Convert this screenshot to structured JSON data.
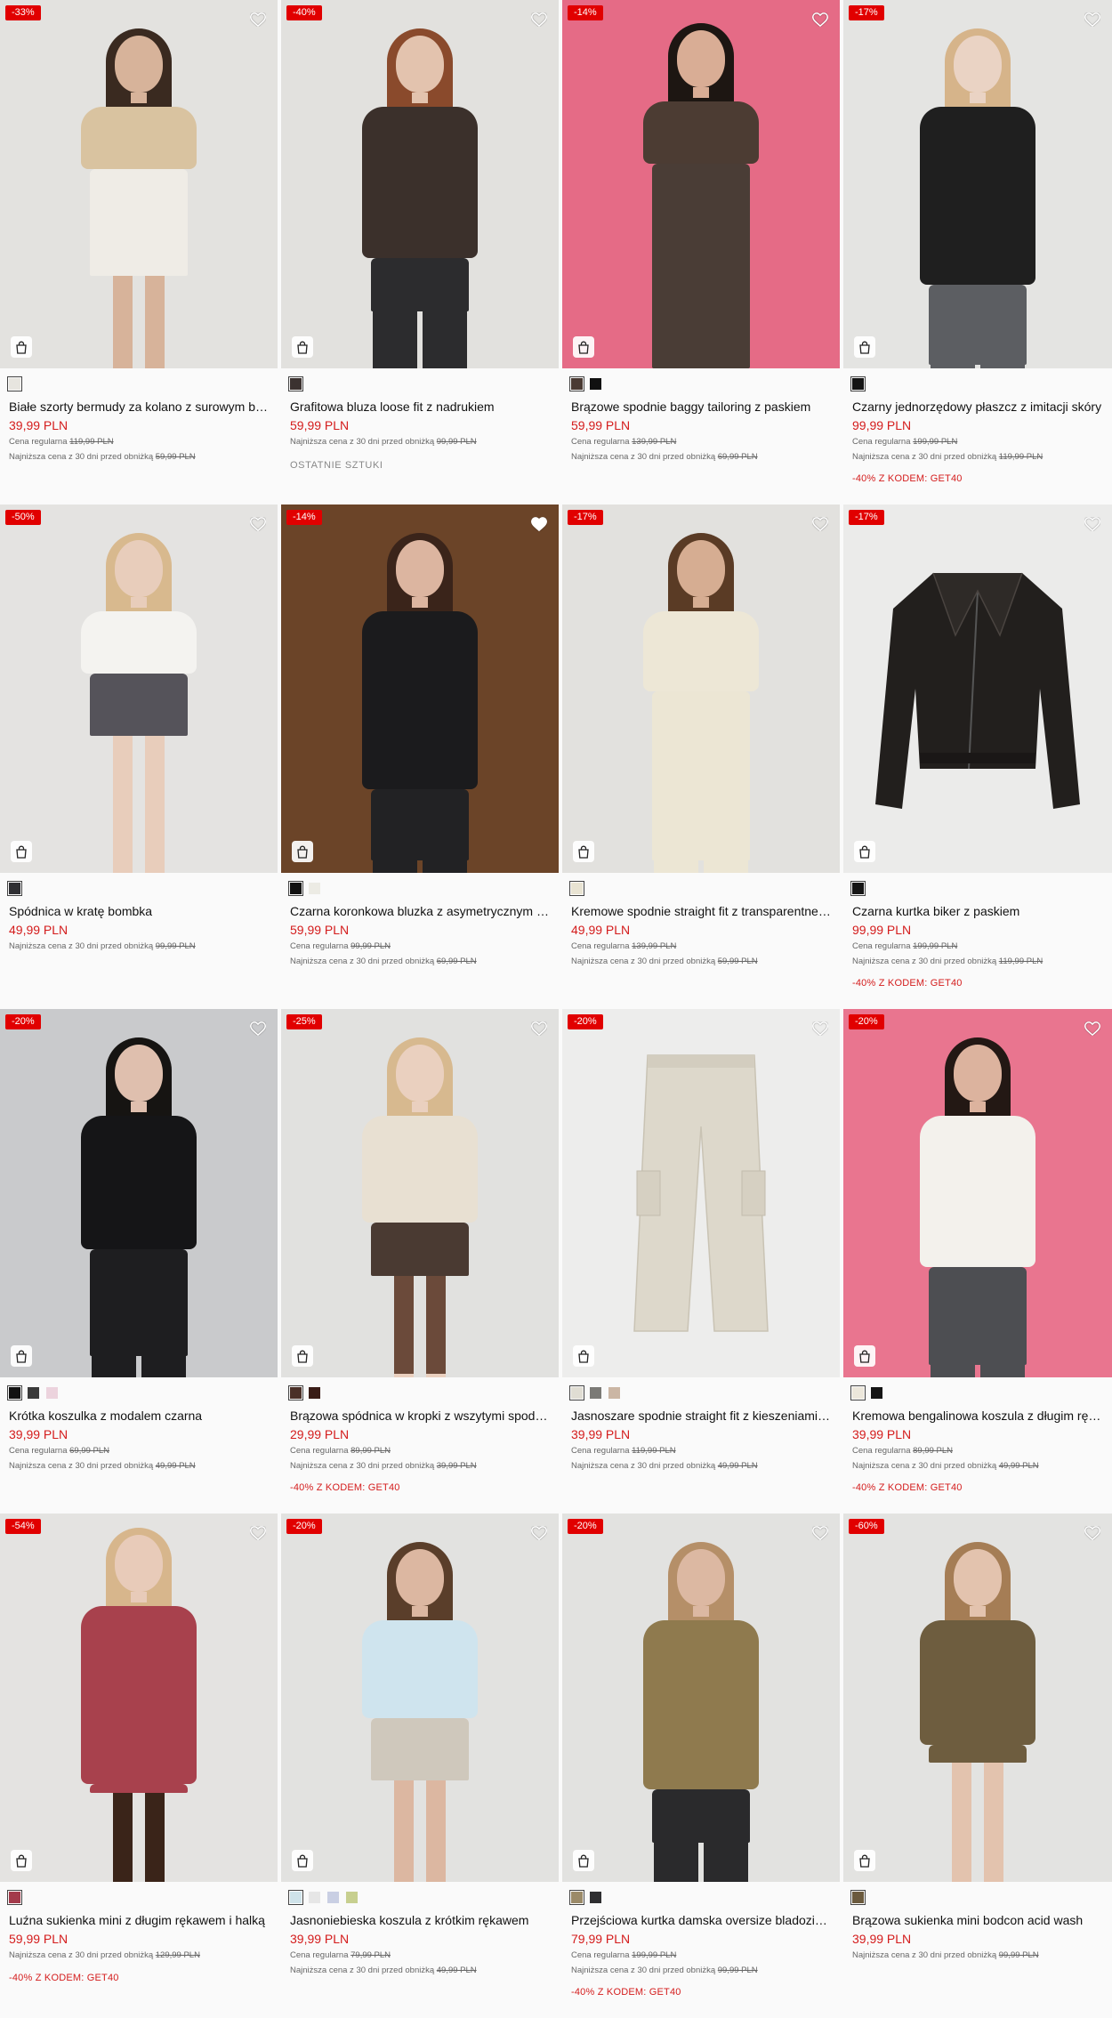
{
  "icons": {
    "favorite": "heart-icon",
    "add_to_cart": "shopping-bag-icon"
  },
  "labels": {
    "regular_price_prefix": "Cena regularna",
    "lowest_price_prefix": "Najniższa cena z 30 dni przed obniżką"
  },
  "colors": {
    "badge_bg": "#e10000",
    "sale_price": "#d41c1c",
    "page_bg": "#fafafa"
  },
  "products": [
    {
      "discount": "-33%",
      "name": "Białe szorty bermudy za kolano z surowym brzegiem",
      "price": "39,99 PLN",
      "regular_price": "119,99 PLN",
      "lowest_price": "59,99 PLN",
      "promo": "",
      "status": "",
      "favorite_filled": false,
      "swatches": [
        {
          "color": "#e7e5df",
          "selected": true
        }
      ],
      "bg": "#e3e2df",
      "art": "model",
      "hair": "#3a2a20",
      "skin": "#d7b39a",
      "top": "#d9c3a0",
      "top_h": 70,
      "bottom": "#efece6",
      "bottom_h": 120,
      "legs": "#d7b39a",
      "legs_h": 60
    },
    {
      "discount": "-40%",
      "name": "Grafitowa bluza loose fit z nadrukiem",
      "price": "59,99 PLN",
      "regular_price": "",
      "lowest_price": "99,99 PLN",
      "promo": "",
      "status": "OSTATNIE SZTUKI",
      "favorite_filled": false,
      "swatches": [
        {
          "color": "#3b3230",
          "selected": true
        }
      ],
      "bg": "#e2e1de",
      "art": "model",
      "hair": "#8a4a2c",
      "skin": "#e3c3ae",
      "top": "#3b302b",
      "top_h": 170,
      "bottom": "#2c2c2e",
      "bottom_h": 60,
      "legs": "#2c2c2e",
      "legs_h": 0
    },
    {
      "discount": "-14%",
      "name": "Brązowe spodnie baggy tailoring z paskiem",
      "price": "59,99 PLN",
      "regular_price": "139,99 PLN",
      "lowest_price": "69,99 PLN",
      "promo": "",
      "status": "",
      "favorite_filled": false,
      "swatches": [
        {
          "color": "#4a3a33",
          "selected": true
        },
        {
          "color": "#111111",
          "selected": false
        }
      ],
      "bg": "#e56b86",
      "art": "model",
      "hair": "#1d1612",
      "skin": "#d9ad95",
      "top": "#4c3c33",
      "top_h": 70,
      "bottom": "#4a3d36",
      "bottom_h": 230,
      "legs": "#4a3d36",
      "legs_h": 0
    },
    {
      "discount": "-17%",
      "name": "Czarny jednorzędowy płaszcz z imitacji skóry",
      "price": "99,99 PLN",
      "regular_price": "199,99 PLN",
      "lowest_price": "119,99 PLN",
      "promo": "-40% Z KODEM: GET40",
      "status": "",
      "favorite_filled": false,
      "swatches": [
        {
          "color": "#151515",
          "selected": true
        }
      ],
      "bg": "#e4e4e2",
      "art": "model",
      "hair": "#d6b48a",
      "skin": "#ead3c4",
      "top": "#1f1f1f",
      "top_h": 200,
      "bottom": "#5c5e62",
      "bottom_h": 90,
      "legs": "#5c5e62",
      "legs_h": 0
    },
    {
      "discount": "-50%",
      "name": "Spódnica w kratę bombka",
      "price": "49,99 PLN",
      "regular_price": "",
      "lowest_price": "99,99 PLN",
      "promo": "",
      "status": "",
      "favorite_filled": false,
      "swatches": [
        {
          "color": "#2f2f33",
          "selected": true
        }
      ],
      "bg": "#e4e3e1",
      "art": "model",
      "hair": "#d8b98e",
      "skin": "#e8cdbb",
      "top": "#f4f3f0",
      "top_h": 70,
      "bottom": "#55535a",
      "bottom_h": 70,
      "legs": "#e8cdbb",
      "legs_h": 100
    },
    {
      "discount": "-14%",
      "name": "Czarna koronkowa bluzka z asymetrycznym dekoltem",
      "price": "59,99 PLN",
      "regular_price": "99,99 PLN",
      "lowest_price": "69,99 PLN",
      "promo": "",
      "status": "",
      "favorite_filled": true,
      "swatches": [
        {
          "color": "#111111",
          "selected": true
        },
        {
          "color": "#ecebe4",
          "selected": false
        }
      ],
      "bg": "#6b4428",
      "art": "model",
      "hair": "#3a241a",
      "skin": "#dcb5a0",
      "top": "#1b1b1d",
      "top_h": 200,
      "bottom": "#222224",
      "bottom_h": 80,
      "legs": "#222224",
      "legs_h": 0
    },
    {
      "discount": "-17%",
      "name": "Kremowe spodnie straight fit z transparentnej dzianiny",
      "price": "49,99 PLN",
      "regular_price": "139,99 PLN",
      "lowest_price": "59,99 PLN",
      "promo": "",
      "status": "",
      "favorite_filled": false,
      "swatches": [
        {
          "color": "#e8e3d2",
          "selected": true
        }
      ],
      "bg": "#e2e1de",
      "art": "model",
      "hair": "#5a3b25",
      "skin": "#d6ad92",
      "top": "#ede7d6",
      "top_h": 90,
      "bottom": "#ece6d4",
      "bottom_h": 190,
      "legs": "#ece6d4",
      "legs_h": 0
    },
    {
      "discount": "-17%",
      "name": "Czarna kurtka biker z paskiem",
      "price": "99,99 PLN",
      "regular_price": "199,99 PLN",
      "lowest_price": "119,99 PLN",
      "promo": "-40% Z KODEM: GET40",
      "status": "",
      "favorite_filled": false,
      "swatches": [
        {
          "color": "#151515",
          "selected": true
        }
      ],
      "bg": "#ebebea",
      "art": "jacket",
      "garment": "#221f1d"
    },
    {
      "discount": "-20%",
      "name": "Krótka koszulka z modalem czarna",
      "price": "39,99 PLN",
      "regular_price": "69,99 PLN",
      "lowest_price": "49,99 PLN",
      "promo": "",
      "status": "",
      "favorite_filled": false,
      "swatches": [
        {
          "color": "#111111",
          "selected": true
        },
        {
          "color": "#3a3a3a",
          "selected": false
        },
        {
          "color": "#ecd3dd",
          "selected": false
        }
      ],
      "bg": "#c9cacc",
      "art": "model",
      "hair": "#161412",
      "skin": "#dfbfae",
      "top": "#151517",
      "top_h": 150,
      "bottom": "#1e1e20",
      "bottom_h": 120,
      "legs": "#1e1e20",
      "legs_h": 0
    },
    {
      "discount": "-25%",
      "name": "Brązowa spódnica w kropki z wszytymi spodenkami",
      "price": "29,99 PLN",
      "regular_price": "89,99 PLN",
      "lowest_price": "39,99 PLN",
      "promo": "-40% Z KODEM: GET40",
      "status": "",
      "favorite_filled": false,
      "swatches": [
        {
          "color": "#4a3028",
          "selected": true
        },
        {
          "color": "#3a1d17",
          "selected": false
        }
      ],
      "bg": "#e1e1df",
      "art": "model",
      "hair": "#d7b98f",
      "skin": "#ead0bf",
      "top": "#e8e0d2",
      "top_h": 120,
      "bottom": "#4a3a32",
      "bottom_h": 60,
      "legs": "#6b4a3a",
      "legs_h": 110
    },
    {
      "discount": "-20%",
      "name": "Jasnoszare spodnie straight fit z kieszeniami cargo",
      "price": "39,99 PLN",
      "regular_price": "119,99 PLN",
      "lowest_price": "49,99 PLN",
      "promo": "",
      "status": "",
      "favorite_filled": false,
      "swatches": [
        {
          "color": "#e0ddd3",
          "selected": true
        },
        {
          "color": "#7b7a76",
          "selected": false
        },
        {
          "color": "#cbb6a4",
          "selected": false
        }
      ],
      "bg": "#ededec",
      "art": "trousers",
      "garment": "#ddd8cb"
    },
    {
      "discount": "-20%",
      "name": "Kremowa bengalinowa koszula z długim rękawem",
      "price": "39,99 PLN",
      "regular_price": "89,99 PLN",
      "lowest_price": "49,99 PLN",
      "promo": "-40% Z KODEM: GET40",
      "status": "",
      "favorite_filled": false,
      "swatches": [
        {
          "color": "#ece7db",
          "selected": true
        },
        {
          "color": "#151515",
          "selected": false
        }
      ],
      "bg": "#e9758f",
      "art": "model",
      "hair": "#231814",
      "skin": "#dcb39e",
      "top": "#f3f1ec",
      "top_h": 170,
      "bottom": "#4d4e52",
      "bottom_h": 110,
      "legs": "#4d4e52",
      "legs_h": 0
    },
    {
      "discount": "-54%",
      "name": "Luźna sukienka mini z długim rękawem i halką",
      "price": "59,99 PLN",
      "regular_price": "",
      "lowest_price": "129,99 PLN",
      "promo": "-40% Z KODEM: GET40",
      "status": "",
      "favorite_filled": false,
      "swatches": [
        {
          "color": "#a33a4a",
          "selected": true
        }
      ],
      "bg": "#e4e3e1",
      "art": "model",
      "hair": "#d7b68c",
      "skin": "#e8cbb9",
      "top": "#a8414d",
      "top_h": 200,
      "bottom": "#a8414d",
      "bottom_h": 10,
      "legs": "#3a2419",
      "legs_h": 100
    },
    {
      "discount": "-20%",
      "name": "Jasnoniebieska koszula z krótkim rękawem",
      "price": "39,99 PLN",
      "regular_price": "79,99 PLN",
      "lowest_price": "49,99 PLN",
      "promo": "",
      "status": "",
      "favorite_filled": false,
      "swatches": [
        {
          "color": "#cfe3ea",
          "selected": true
        },
        {
          "color": "#e6e6e6",
          "selected": false
        },
        {
          "color": "#c9cfe3",
          "selected": false
        },
        {
          "color": "#c7cf8f",
          "selected": false
        }
      ],
      "bg": "#e2e2e0",
      "art": "model",
      "hair": "#5a3e2a",
      "skin": "#dcb7a1",
      "top": "#cfe4ee",
      "top_h": 110,
      "bottom": "#cfc8bc",
      "bottom_h": 70,
      "legs": "#dcb7a1",
      "legs_h": 40
    },
    {
      "discount": "-20%",
      "name": "Przejściowa kurtka damska oversize bladozielona",
      "price": "79,99 PLN",
      "regular_price": "199,99 PLN",
      "lowest_price": "99,99 PLN",
      "promo": "-40% Z KODEM: GET40",
      "status": "",
      "favorite_filled": false,
      "swatches": [
        {
          "color": "#9b8a68",
          "selected": true
        },
        {
          "color": "#2e2e30",
          "selected": false
        }
      ],
      "bg": "#e2e2e0",
      "art": "model",
      "hair": "#b58f68",
      "skin": "#dcb8a2",
      "top": "#8f7a4e",
      "top_h": 190,
      "bottom": "#2a2a2c",
      "bottom_h": 60,
      "legs": "#2a2a2c",
      "legs_h": 0
    },
    {
      "discount": "-60%",
      "name": "Brązowa sukienka mini bodcon acid wash",
      "price": "39,99 PLN",
      "regular_price": "",
      "lowest_price": "99,99 PLN",
      "promo": "",
      "status": "",
      "favorite_filled": false,
      "swatches": [
        {
          "color": "#6b5a3e",
          "selected": true
        }
      ],
      "bg": "#e3e3e1",
      "art": "model",
      "hair": "#a57d55",
      "skin": "#e3c3ae",
      "top": "#6e5d3f",
      "top_h": 140,
      "bottom": "#6e5d3f",
      "bottom_h": 20,
      "legs": "#e3c3ae",
      "legs_h": 90
    }
  ]
}
